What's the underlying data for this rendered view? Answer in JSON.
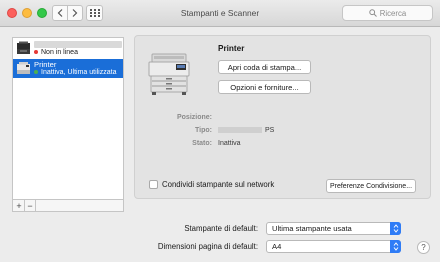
{
  "window": {
    "title": "Stampanti e Scanner"
  },
  "search": {
    "placeholder": "Ricerca"
  },
  "printers": [
    {
      "name": "",
      "status": "Non in linea",
      "status_color": "#e53935"
    },
    {
      "name": "Printer",
      "status": "Inattiva, Ultima utilizzata",
      "status_color": "#4caf50"
    }
  ],
  "list_controls": {
    "add": "+",
    "remove": "−"
  },
  "detail": {
    "name": "Printer",
    "open_queue_label": "Apri coda di stampa...",
    "options_label": "Opzioni e forniture...",
    "location_label": "Posizione:",
    "location_value": "",
    "kind_label": "Tipo:",
    "kind_value": "PS",
    "status_label": "Stato:",
    "status_value": "Inattiva",
    "share_label": "Condividi stampante sul network",
    "share_checked": false,
    "sharing_prefs_label": "Preferenze Condivisione..."
  },
  "defaults": {
    "printer_label": "Stampante di default:",
    "printer_value": "Ultima stampante usata",
    "paper_label": "Dimensioni pagina di default:",
    "paper_value": "A4"
  },
  "help_label": "?",
  "colors": {
    "accent": "#2f7cf6",
    "selection": "#1a6ed8"
  }
}
